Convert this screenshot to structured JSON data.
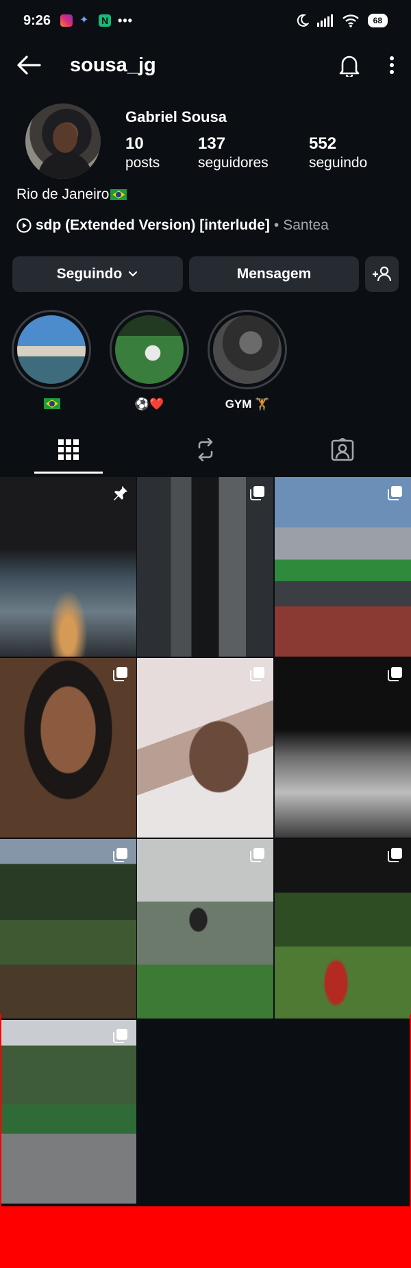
{
  "status_bar": {
    "time": "9:26",
    "battery": "68"
  },
  "header": {
    "username": "sousa_jg"
  },
  "profile": {
    "full_name": "Gabriel Sousa",
    "stats": [
      {
        "num": "10",
        "label": "posts"
      },
      {
        "num": "137",
        "label": "seguidores"
      },
      {
        "num": "552",
        "label": "seguindo"
      }
    ],
    "bio": "Rio de Janeiro",
    "music": {
      "song": "sdp (Extended Version) [interlude]",
      "separator": "•",
      "artist": "Santea"
    }
  },
  "actions": {
    "following": "Seguindo",
    "message": "Mensagem"
  },
  "highlights": [
    {
      "label": ""
    },
    {
      "label": "⚽❤️"
    },
    {
      "label": "GYM 🏋"
    }
  ],
  "tabs": [
    "grid",
    "reels",
    "tagged"
  ],
  "colors": {
    "background": "#0b0e13",
    "button": "#262a31",
    "muted": "#a4a8ad",
    "red_bar": "#ff0000"
  }
}
